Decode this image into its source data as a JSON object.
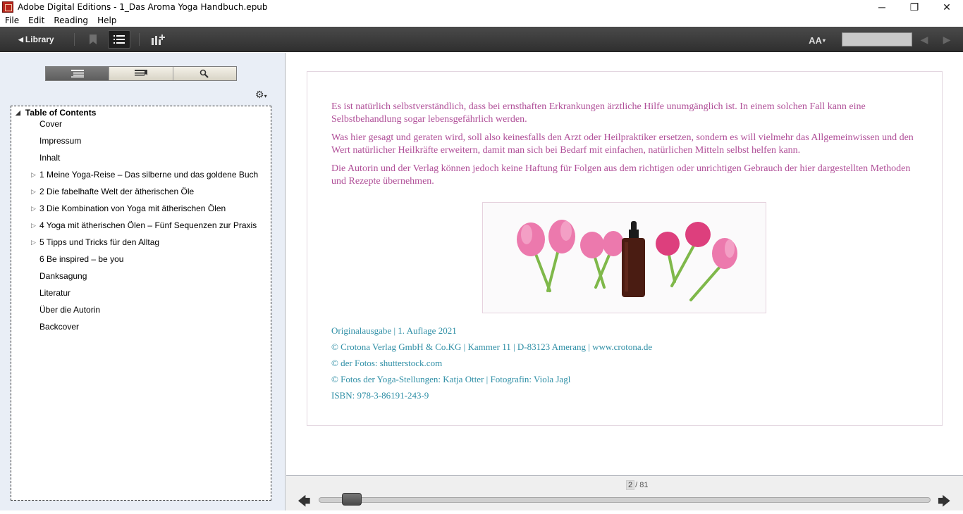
{
  "window": {
    "title": "Adobe Digital Editions - 1_Das Aroma Yoga Handbuch.epub",
    "minimize": "─",
    "restore": "❐",
    "close": "✕"
  },
  "menu": {
    "items": [
      {
        "label": "File"
      },
      {
        "label": "Edit"
      },
      {
        "label": "Reading"
      },
      {
        "label": "Help"
      }
    ]
  },
  "toolbar": {
    "library_label": "Library",
    "font_label": "AA",
    "page_input_value": ""
  },
  "sidebar": {
    "tabs": [
      "toc",
      "bookmarks",
      "search"
    ],
    "toc_title": "Table of Contents",
    "toc": [
      {
        "label": "Cover",
        "expandable": false
      },
      {
        "label": "Impressum",
        "expandable": false
      },
      {
        "label": "Inhalt",
        "expandable": false
      },
      {
        "label": "1 Meine Yoga-Reise – Das silberne und das goldene Buch",
        "expandable": true
      },
      {
        "label": "2 Die fabelhafte Welt der ätherischen Öle",
        "expandable": true
      },
      {
        "label": "3 Die Kombination von Yoga mit ätherischen Ölen",
        "expandable": true
      },
      {
        "label": "4 Yoga mit ätherischen Ölen – Fünf Sequenzen zur Praxis",
        "expandable": true
      },
      {
        "label": "5 Tipps und Tricks für den Alltag",
        "expandable": true
      },
      {
        "label": "6 Be inspired – be you",
        "expandable": false
      },
      {
        "label": "Danksagung",
        "expandable": false
      },
      {
        "label": "Literatur",
        "expandable": false
      },
      {
        "label": "Über die Autorin",
        "expandable": false
      },
      {
        "label": "Backcover",
        "expandable": false
      }
    ]
  },
  "page": {
    "paragraphs": [
      "Es ist natürlich selbstverständlich, dass bei ernsthaften Erkrankungen ärztliche Hilfe unumgänglich ist. In einem solchen Fall kann eine Selbstbehandlung sogar lebensgefährlich werden.",
      "Was hier gesagt und geraten wird, soll also keinesfalls den Arzt oder Heilpraktiker ersetzen, sondern es will vielmehr das Allgemeinwissen und den Wert natürlicher Heilkräfte erweitern, damit man sich bei Bedarf mit einfachen, natürlichen Mitteln selbst helfen kann.",
      "Die Autorin und der Verlag können jedoch keine Haftung für Folgen aus dem richtigen oder unrichtigen Gebrauch der hier dargestellten Methoden und Rezepte übernehmen."
    ],
    "imprint": [
      "Originalausgabe | 1. Auflage 2021",
      "© Crotona Verlag GmbH & Co.KG | Kammer 11 | D-83123 Amerang | www.crotona.de",
      "© der Fotos: shutterstock.com",
      "© Fotos der Yoga-Stellungen: Katja Otter | Fotografin: Viola Jagl",
      "ISBN: 978-3-86191-243-9"
    ],
    "colors": {
      "body_text": "#b04f98",
      "imprint_text": "#2f8fa6",
      "flower": "#e86aa6",
      "stem": "#7fb84a",
      "bottle": "#4a1c12"
    }
  },
  "pager": {
    "current": "2",
    "total": "/ 81",
    "progress_fraction": 0.025
  }
}
